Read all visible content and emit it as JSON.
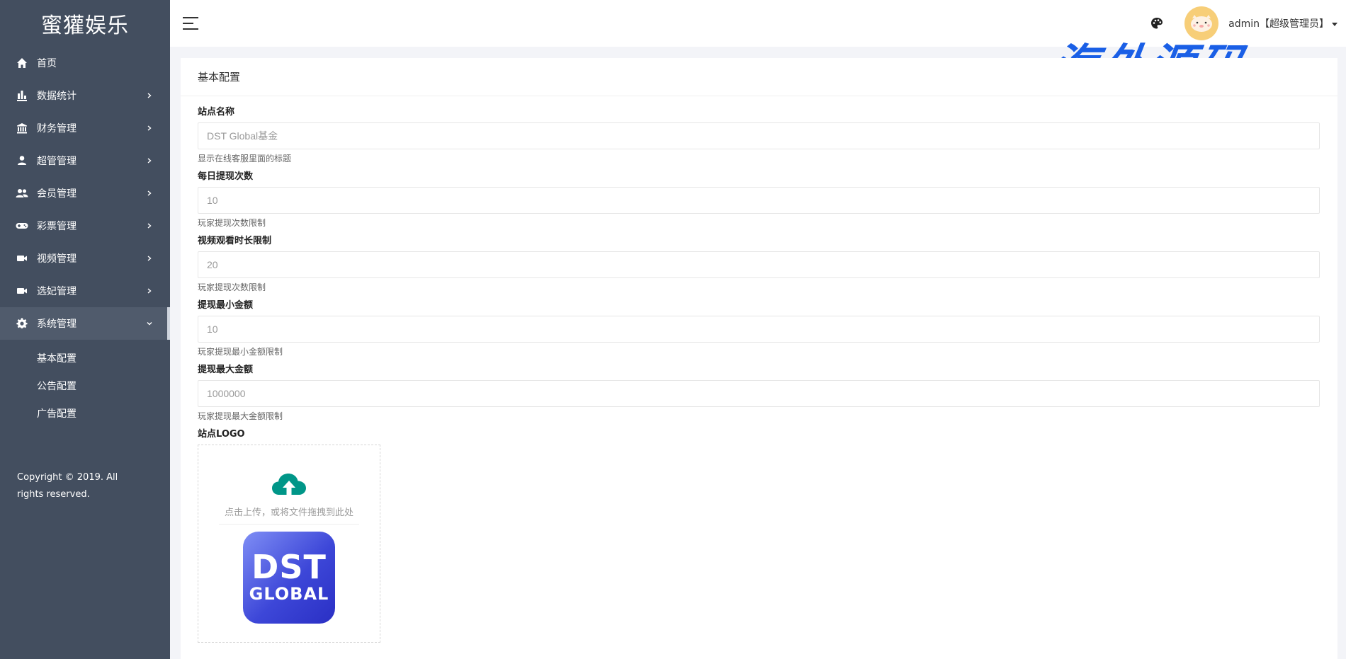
{
  "sidebar": {
    "brand": "蜜獾娱乐",
    "items": [
      {
        "label": "首页",
        "icon": "home-icon"
      },
      {
        "label": "数据统计",
        "icon": "bar-chart-icon"
      },
      {
        "label": "财务管理",
        "icon": "bank-icon"
      },
      {
        "label": "超管管理",
        "icon": "user-icon"
      },
      {
        "label": "会员管理",
        "icon": "users-icon"
      },
      {
        "label": "彩票管理",
        "icon": "gamepad-icon"
      },
      {
        "label": "视频管理",
        "icon": "video-icon"
      },
      {
        "label": "选妃管理",
        "icon": "video-icon"
      },
      {
        "label": "系统管理",
        "icon": "gear-icon"
      }
    ],
    "submenu": [
      "基本配置",
      "公告配置",
      "广告配置"
    ],
    "copyright": "Copyright © 2019. All rights reserved."
  },
  "header": {
    "user_name": "admin【超级管理员】",
    "watermark": "海外源码"
  },
  "card": {
    "title": "基本配置",
    "fields": [
      {
        "label": "站点名称",
        "placeholder": "DST Global基金",
        "help": "显示在线客服里面的标题"
      },
      {
        "label": "每日提现次数",
        "placeholder": "10",
        "help": "玩家提现次数限制"
      },
      {
        "label": "视频观看时长限制",
        "placeholder": "20",
        "help": "玩家提现次数限制"
      },
      {
        "label": "提现最小金额",
        "placeholder": "10",
        "help": "玩家提现最小金额限制"
      },
      {
        "label": "提现最大金额",
        "placeholder": "1000000",
        "help": "玩家提现最大金额限制"
      }
    ],
    "logo_label": "站点LOGO",
    "upload_text": "点击上传，或将文件拖拽到此处",
    "logo_line1": "DST",
    "logo_line2": "GLOBAL"
  },
  "colors": {
    "sidebar_bg": "#434e5f",
    "upload_icon": "#009688",
    "watermark": "#1a5fe6",
    "avatar_bg": "#f7ce78"
  }
}
